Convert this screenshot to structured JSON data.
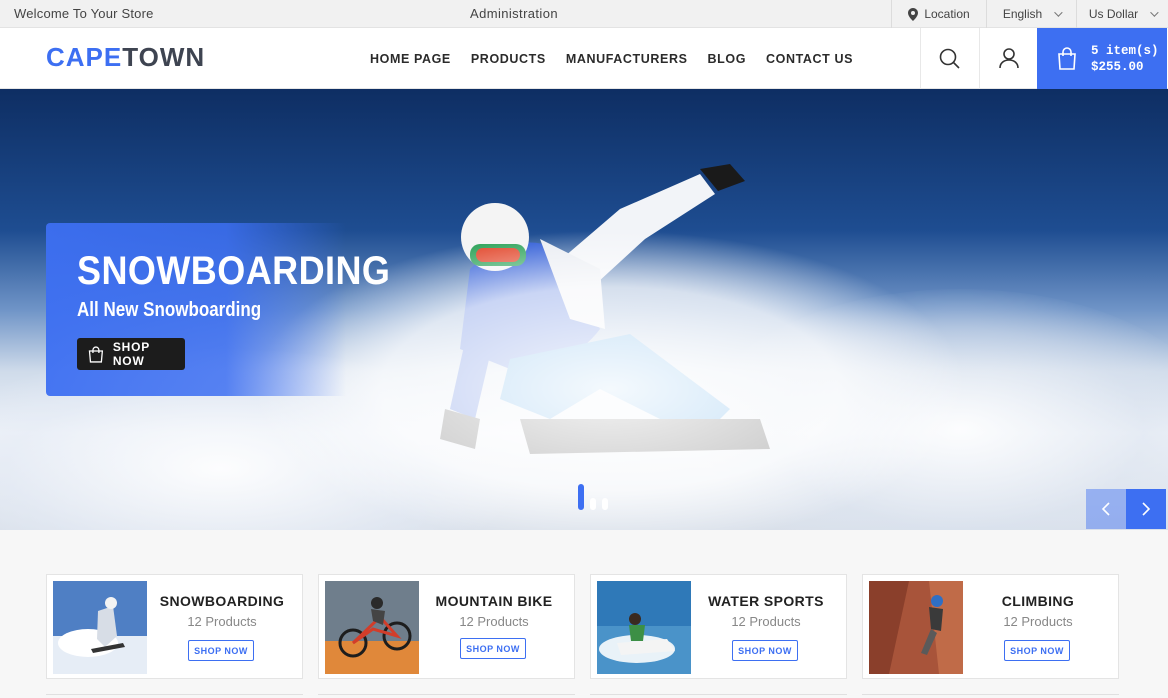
{
  "topbar": {
    "welcome": "Welcome To Your Store",
    "admin": "Administration",
    "location": "Location",
    "language": "English",
    "currency": "Us Dollar"
  },
  "header": {
    "logo_part1": "CAPE",
    "logo_part2": "TOWN",
    "nav": [
      "HOME PAGE",
      "PRODUCTS",
      "MANUFACTURERS",
      "BLOG",
      "CONTACT US"
    ],
    "cart_items": "5 item(s)",
    "cart_total": "$255.00"
  },
  "hero": {
    "title": "SNOWBOARDING",
    "subtitle": "All New Snowboarding",
    "button": "SHOP NOW",
    "slides": 3,
    "active_slide": 1
  },
  "categories": [
    {
      "name": "SNOWBOARDING",
      "count": "12 Products",
      "button": "SHOP NOW"
    },
    {
      "name": "MOUNTAIN BIKE",
      "count": "12 Products",
      "button": "SHOP NOW"
    },
    {
      "name": "WATER SPORTS",
      "count": "12 Products",
      "button": "SHOP NOW"
    },
    {
      "name": "CLIMBING",
      "count": "12 Products",
      "button": "SHOP NOW"
    }
  ],
  "colors": {
    "accent": "#3d6ff2",
    "dark": "#1c1c1c"
  },
  "icons": [
    "location-pin-icon",
    "chevron-down-icon",
    "search-icon",
    "user-icon",
    "shopping-bag-icon",
    "arrow-left-icon",
    "arrow-right-icon"
  ]
}
